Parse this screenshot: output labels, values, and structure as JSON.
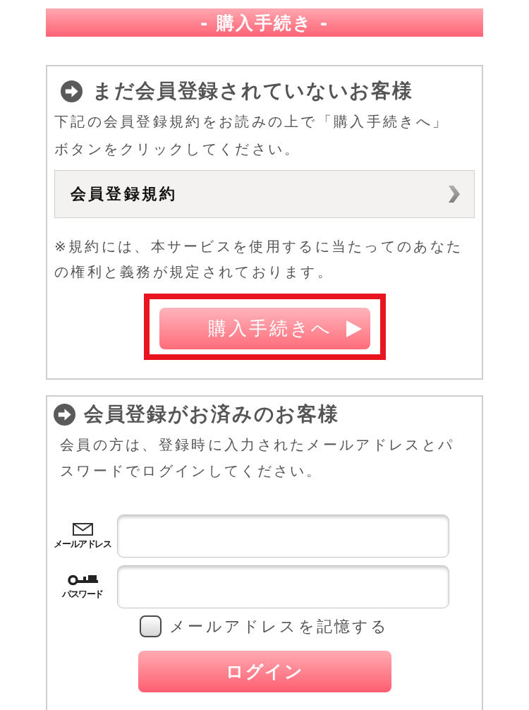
{
  "header": {
    "title": "- 購入手続き -"
  },
  "guest_section": {
    "heading": "まだ会員登録されていないお客様",
    "intro": "下記の会員登録規約をお読みの上で「購入手続きへ」ボタンをクリックしてください。",
    "terms_link": {
      "label": "会員登録規約"
    },
    "note": "※規約には、本サービスを使用するに当たってのあなたの権利と義務が規定されております。",
    "proceed_button": {
      "label": "購入手続きへ",
      "highlighted": true
    }
  },
  "member_section": {
    "heading": "会員登録がお済みのお客様",
    "intro": "会員の方は、登録時に入力されたメールアドレスとパスワードでログインしてください。",
    "fields": [
      {
        "kind": "email",
        "label": "メールアドレス"
      },
      {
        "kind": "password",
        "label": "パスワード"
      }
    ],
    "remember": {
      "label": "メールアドレスを記憶する",
      "checked": false
    },
    "login_button": {
      "label": "ログイン"
    }
  }
}
